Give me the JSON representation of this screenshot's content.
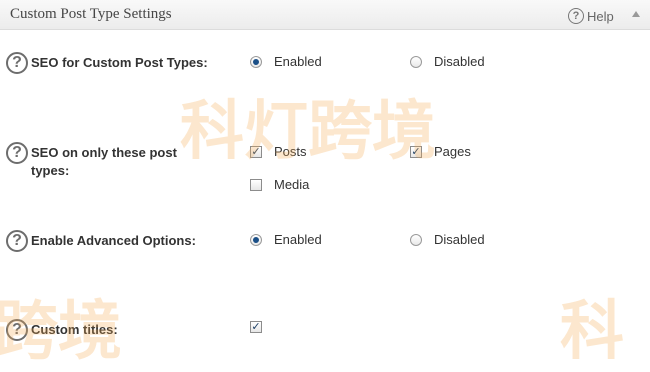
{
  "panel": {
    "title": "Custom Post Type Settings",
    "help_label": "Help"
  },
  "rows": [
    {
      "label": "SEO for Custom Post Types:",
      "options": [
        {
          "label": "Enabled",
          "type": "radio",
          "checked": true
        },
        {
          "label": "Disabled",
          "type": "radio",
          "checked": false
        }
      ]
    },
    {
      "label": "SEO on only these post types:",
      "options": [
        {
          "label": "Posts",
          "type": "checkbox",
          "checked": true
        },
        {
          "label": "Pages",
          "type": "checkbox",
          "checked": true
        },
        {
          "label": "Media",
          "type": "checkbox",
          "checked": false
        }
      ]
    },
    {
      "label": "Enable Advanced Options:",
      "options": [
        {
          "label": "Enabled",
          "type": "radio",
          "checked": true
        },
        {
          "label": "Disabled",
          "type": "radio",
          "checked": false
        }
      ]
    },
    {
      "label": "Custom titles:",
      "options": [
        {
          "type": "checkbox",
          "checked": true
        }
      ]
    }
  ],
  "watermark": {
    "text_main": "科灯跨境",
    "text_left": "跨境",
    "text_right": "科"
  }
}
